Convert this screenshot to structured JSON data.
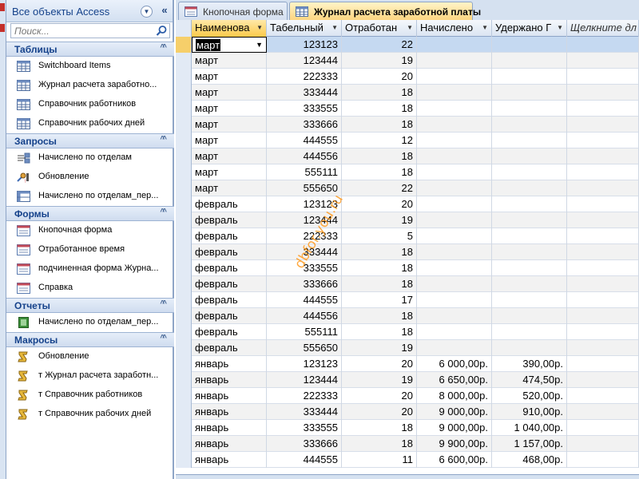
{
  "nav": {
    "title": "Все объекты Access",
    "search_placeholder": "Поиск...",
    "groups": [
      {
        "title": "Таблицы",
        "items": [
          {
            "label": "Switchboard Items",
            "icon": "table-icon"
          },
          {
            "label": "Журнал расчета заработно...",
            "icon": "table-icon"
          },
          {
            "label": "Справочник работников",
            "icon": "table-icon"
          },
          {
            "label": "Справочник рабочих дней",
            "icon": "table-icon"
          }
        ]
      },
      {
        "title": "Запросы",
        "items": [
          {
            "label": "Начислено по отделам",
            "icon": "query-icon"
          },
          {
            "label": "Обновление",
            "icon": "update-query-icon"
          },
          {
            "label": "Начислено по отделам_пер...",
            "icon": "crosstab-query-icon"
          }
        ]
      },
      {
        "title": "Формы",
        "items": [
          {
            "label": "Кнопочная форма",
            "icon": "form-icon"
          },
          {
            "label": "Отработанное время",
            "icon": "form-icon"
          },
          {
            "label": "подчиненная форма Журна...",
            "icon": "form-icon"
          },
          {
            "label": "Справка",
            "icon": "form-icon"
          }
        ]
      },
      {
        "title": "Отчеты",
        "items": [
          {
            "label": "Начислено по отделам_пер...",
            "icon": "report-icon"
          }
        ]
      },
      {
        "title": "Макросы",
        "items": [
          {
            "label": "Обновление",
            "icon": "macro-icon"
          },
          {
            "label": "т Журнал расчета заработн...",
            "icon": "macro-icon"
          },
          {
            "label": "т Справочник работников",
            "icon": "macro-icon"
          },
          {
            "label": "т Справочник рабочих дней",
            "icon": "macro-icon"
          }
        ]
      }
    ]
  },
  "tabs": [
    {
      "label": "Кнопочная форма",
      "icon": "form-icon",
      "active": false
    },
    {
      "label": "Журнал расчета заработной платы",
      "icon": "table-icon",
      "active": true
    }
  ],
  "grid": {
    "columns": [
      "Наименова",
      "Табельный",
      "Отработан",
      "Начислено",
      "Удержано Г",
      "Щелкните дл"
    ],
    "rows": [
      [
        "март",
        "123123",
        "22",
        "",
        ""
      ],
      [
        "март",
        "123444",
        "19",
        "",
        ""
      ],
      [
        "март",
        "222333",
        "20",
        "",
        ""
      ],
      [
        "март",
        "333444",
        "18",
        "",
        ""
      ],
      [
        "март",
        "333555",
        "18",
        "",
        ""
      ],
      [
        "март",
        "333666",
        "18",
        "",
        ""
      ],
      [
        "март",
        "444555",
        "12",
        "",
        ""
      ],
      [
        "март",
        "444556",
        "18",
        "",
        ""
      ],
      [
        "март",
        "555111",
        "18",
        "",
        ""
      ],
      [
        "март",
        "555650",
        "22",
        "",
        ""
      ],
      [
        "февраль",
        "123123",
        "20",
        "",
        ""
      ],
      [
        "февраль",
        "123444",
        "19",
        "",
        ""
      ],
      [
        "февраль",
        "222333",
        "5",
        "",
        ""
      ],
      [
        "февраль",
        "333444",
        "18",
        "",
        ""
      ],
      [
        "февраль",
        "333555",
        "18",
        "",
        ""
      ],
      [
        "февраль",
        "333666",
        "18",
        "",
        ""
      ],
      [
        "февраль",
        "444555",
        "17",
        "",
        ""
      ],
      [
        "февраль",
        "444556",
        "18",
        "",
        ""
      ],
      [
        "февраль",
        "555111",
        "18",
        "",
        ""
      ],
      [
        "февраль",
        "555650",
        "19",
        "",
        ""
      ],
      [
        "январь",
        "123123",
        "20",
        "6 000,00р.",
        "390,00р."
      ],
      [
        "январь",
        "123444",
        "19",
        "6 650,00р.",
        "474,50р."
      ],
      [
        "январь",
        "222333",
        "20",
        "8 000,00р.",
        "520,00р."
      ],
      [
        "январь",
        "333444",
        "20",
        "9 000,00р.",
        "910,00р."
      ],
      [
        "январь",
        "333555",
        "18",
        "9 000,00р.",
        "1 040,00р."
      ],
      [
        "январь",
        "333666",
        "18",
        "9 900,00р.",
        "1 157,00р."
      ],
      [
        "январь",
        "444555",
        "11",
        "6 600,00р.",
        "468,00р."
      ]
    ]
  },
  "watermark": "dbfor.you.ru",
  "colors": {
    "accent": "#15428b",
    "active_tab": "#fcd27a",
    "selected_row": "#c5d9f1",
    "watermark": "#ff9a1e"
  }
}
